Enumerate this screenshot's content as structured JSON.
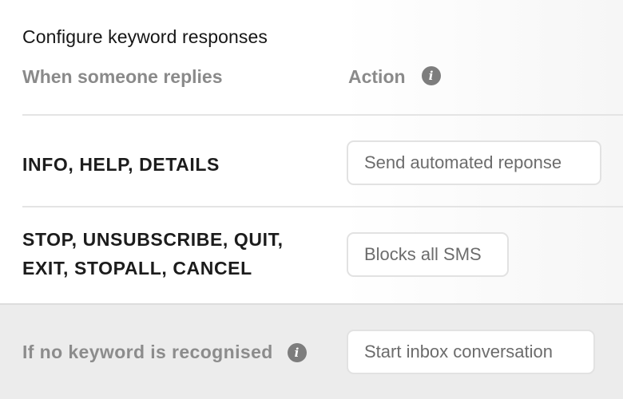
{
  "title": "Configure keyword responses",
  "columns": {
    "left": "When someone replies",
    "right": "Action",
    "right_icon": "info-icon"
  },
  "rows": [
    {
      "keywords_line1": "INFO, HELP, DETAILS",
      "keywords_line2": "",
      "action": "Send automated reponse"
    },
    {
      "keywords_line1": "STOP, UNSUBSCRIBE, QUIT,",
      "keywords_line2": "EXIT, STOPALL, CANCEL",
      "action": "Blocks all SMS"
    }
  ],
  "fallback": {
    "label": "If no keyword is recognised",
    "icon": "info-icon",
    "action": "Start inbox conversation"
  },
  "colors": {
    "footer_bg": "#ececec",
    "muted_text": "#8a8a8a",
    "icon_fill": "#7d7d7d",
    "button_border": "#e2e2e2"
  }
}
